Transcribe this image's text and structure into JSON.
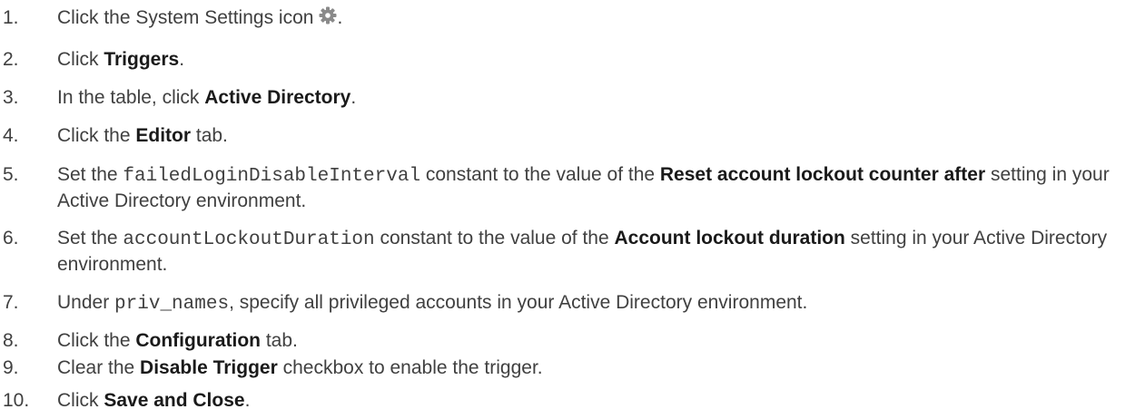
{
  "steps": [
    {
      "num": "1.",
      "parts": [
        {
          "t": "Click the System Settings icon",
          "s": "plain"
        },
        {
          "icon": "gear-icon"
        },
        {
          "t": ".",
          "s": "plain"
        }
      ]
    },
    {
      "num": "2.",
      "parts": [
        {
          "t": "Click ",
          "s": "plain"
        },
        {
          "t": "Triggers",
          "s": "bold"
        },
        {
          "t": ".",
          "s": "plain"
        }
      ]
    },
    {
      "num": "3.",
      "parts": [
        {
          "t": "In the table, click ",
          "s": "plain"
        },
        {
          "t": "Active Directory",
          "s": "bold"
        },
        {
          "t": ".",
          "s": "plain"
        }
      ]
    },
    {
      "num": "4.",
      "parts": [
        {
          "t": "Click the ",
          "s": "plain"
        },
        {
          "t": "Editor",
          "s": "bold"
        },
        {
          "t": " tab.",
          "s": "plain"
        }
      ]
    },
    {
      "num": "5.",
      "parts": [
        {
          "t": "Set the ",
          "s": "plain"
        },
        {
          "t": "failedLoginDisableInterval",
          "s": "code"
        },
        {
          "t": " constant to the value of the ",
          "s": "plain"
        },
        {
          "t": "Reset account lockout counter after",
          "s": "bold"
        },
        {
          "t": " setting in your Active Directory environment.",
          "s": "plain"
        }
      ]
    },
    {
      "num": "6.",
      "parts": [
        {
          "t": "Set the ",
          "s": "plain"
        },
        {
          "t": "accountLockoutDuration",
          "s": "code"
        },
        {
          "t": " constant to the value of the ",
          "s": "plain"
        },
        {
          "t": "Account lockout duration",
          "s": "bold"
        },
        {
          "t": " setting in your Active Directory environment.",
          "s": "plain"
        }
      ]
    },
    {
      "num": "7.",
      "parts": [
        {
          "t": "Under ",
          "s": "plain"
        },
        {
          "t": "priv_names",
          "s": "code"
        },
        {
          "t": ", specify all privileged accounts in your Active Directory environment.",
          "s": "plain"
        }
      ]
    },
    {
      "num": "8.",
      "parts": [
        {
          "t": "Click the ",
          "s": "plain"
        },
        {
          "t": "Configuration",
          "s": "bold"
        },
        {
          "t": " tab.",
          "s": "plain"
        }
      ]
    },
    {
      "num": "9.",
      "parts": [
        {
          "t": "Clear the ",
          "s": "plain"
        },
        {
          "t": "Disable Trigger",
          "s": "bold"
        },
        {
          "t": " checkbox to enable the trigger.",
          "s": "plain"
        }
      ]
    },
    {
      "num": "10.",
      "parts": [
        {
          "t": "Click ",
          "s": "plain"
        },
        {
          "t": "Save and Close",
          "s": "bold"
        },
        {
          "t": ".",
          "s": "plain"
        }
      ]
    }
  ]
}
